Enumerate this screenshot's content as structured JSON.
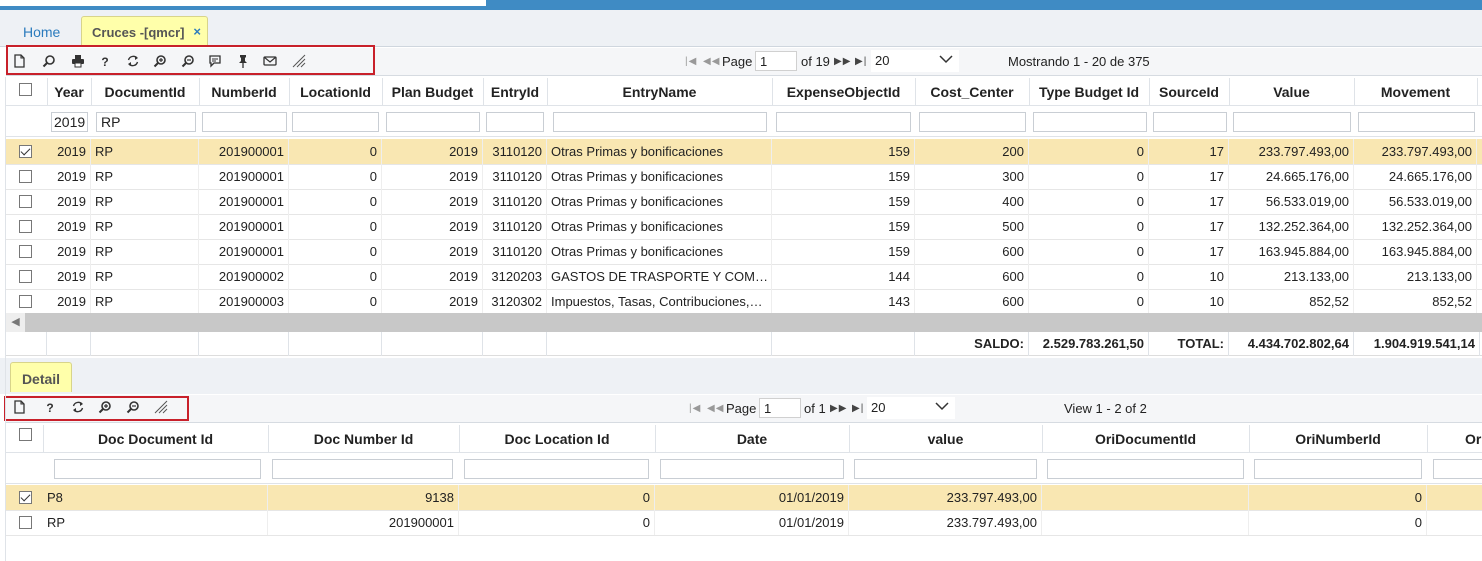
{
  "tabs": {
    "home": "Home",
    "active": "Cruces -[qmcr]",
    "close_glyph": "×"
  },
  "main": {
    "toolbar_icons": [
      "new-icon",
      "search-icon",
      "print-icon",
      "help-icon",
      "refresh-icon",
      "zoom-in-icon",
      "zoom-out-icon",
      "comment-icon",
      "pin-icon",
      "mail-icon",
      "resize-icon"
    ],
    "pager": {
      "page_label": "Page",
      "page_value": "1",
      "of_label": "of 19",
      "page_size": "20",
      "status": "Mostrando 1 - 20 de 375"
    },
    "columns": [
      "Year",
      "DocumentId",
      "NumberId",
      "LocationId",
      "Plan Budget",
      "EntryId",
      "EntryName",
      "ExpenseObjectId",
      "Cost_Center",
      "Type Budget Id",
      "SourceId",
      "Value",
      "Movement"
    ],
    "filters": {
      "year": "2019",
      "document": "RP"
    },
    "rows": [
      {
        "checked": true,
        "year": "2019",
        "doc": "RP",
        "number": "201900001",
        "location": "0",
        "plan": "2019",
        "entry": "3110120",
        "name": "Otras Primas y bonificaciones",
        "expense": "159",
        "cost": "200",
        "type": "0",
        "source": "17",
        "value": "233.797.493,00",
        "movement": "233.797.493,00"
      },
      {
        "checked": false,
        "year": "2019",
        "doc": "RP",
        "number": "201900001",
        "location": "0",
        "plan": "2019",
        "entry": "3110120",
        "name": "Otras Primas y bonificaciones",
        "expense": "159",
        "cost": "300",
        "type": "0",
        "source": "17",
        "value": "24.665.176,00",
        "movement": "24.665.176,00"
      },
      {
        "checked": false,
        "year": "2019",
        "doc": "RP",
        "number": "201900001",
        "location": "0",
        "plan": "2019",
        "entry": "3110120",
        "name": "Otras Primas y bonificaciones",
        "expense": "159",
        "cost": "400",
        "type": "0",
        "source": "17",
        "value": "56.533.019,00",
        "movement": "56.533.019,00"
      },
      {
        "checked": false,
        "year": "2019",
        "doc": "RP",
        "number": "201900001",
        "location": "0",
        "plan": "2019",
        "entry": "3110120",
        "name": "Otras Primas y bonificaciones",
        "expense": "159",
        "cost": "500",
        "type": "0",
        "source": "17",
        "value": "132.252.364,00",
        "movement": "132.252.364,00"
      },
      {
        "checked": false,
        "year": "2019",
        "doc": "RP",
        "number": "201900001",
        "location": "0",
        "plan": "2019",
        "entry": "3110120",
        "name": "Otras Primas y bonificaciones",
        "expense": "159",
        "cost": "600",
        "type": "0",
        "source": "17",
        "value": "163.945.884,00",
        "movement": "163.945.884,00"
      },
      {
        "checked": false,
        "year": "2019",
        "doc": "RP",
        "number": "201900002",
        "location": "0",
        "plan": "2019",
        "entry": "3120203",
        "name": "GASTOS DE TRASPORTE Y COM…",
        "expense": "144",
        "cost": "600",
        "type": "0",
        "source": "10",
        "value": "213.133,00",
        "movement": "213.133,00"
      },
      {
        "checked": false,
        "year": "2019",
        "doc": "RP",
        "number": "201900003",
        "location": "0",
        "plan": "2019",
        "entry": "3120302",
        "name": "Impuestos, Tasas, Contribuciones,…",
        "expense": "143",
        "cost": "600",
        "type": "0",
        "source": "10",
        "value": "852,52",
        "movement": "852,52"
      }
    ],
    "footer": {
      "saldo_label": "SALDO:",
      "saldo_value": "2.529.783.261,50",
      "total_label": "TOTAL:",
      "total_value": "4.434.702.802,64",
      "movement_total": "1.904.919.541,14"
    }
  },
  "detail": {
    "tab_label": "Detail",
    "toolbar_icons": [
      "new-icon",
      "help-icon",
      "refresh-icon",
      "zoom-in-icon",
      "zoom-out-icon",
      "resize-icon"
    ],
    "pager": {
      "page_label": "Page",
      "page_value": "1",
      "of_label": "of 1",
      "page_size": "20",
      "status": "View 1 - 2 of 2"
    },
    "columns": [
      "Doc Document Id",
      "Doc Number Id",
      "Doc Location Id",
      "Date",
      "value",
      "OriDocumentId",
      "OriNumberId",
      "Or"
    ],
    "rows": [
      {
        "checked": true,
        "doc": "P8",
        "number": "9138",
        "location": "0",
        "date": "01/01/2019",
        "value": "233.797.493,00",
        "oridoc": "",
        "orinum": "0"
      },
      {
        "checked": false,
        "doc": "RP",
        "number": "201900001",
        "location": "0",
        "date": "01/01/2019",
        "value": "233.797.493,00",
        "oridoc": "",
        "orinum": "0"
      }
    ]
  },
  "colors": {
    "accent": "#3f8bc4",
    "selected_row": "#f9e7b2",
    "active_tab": "#ffffaa",
    "highlight_box": "#c8202a"
  }
}
